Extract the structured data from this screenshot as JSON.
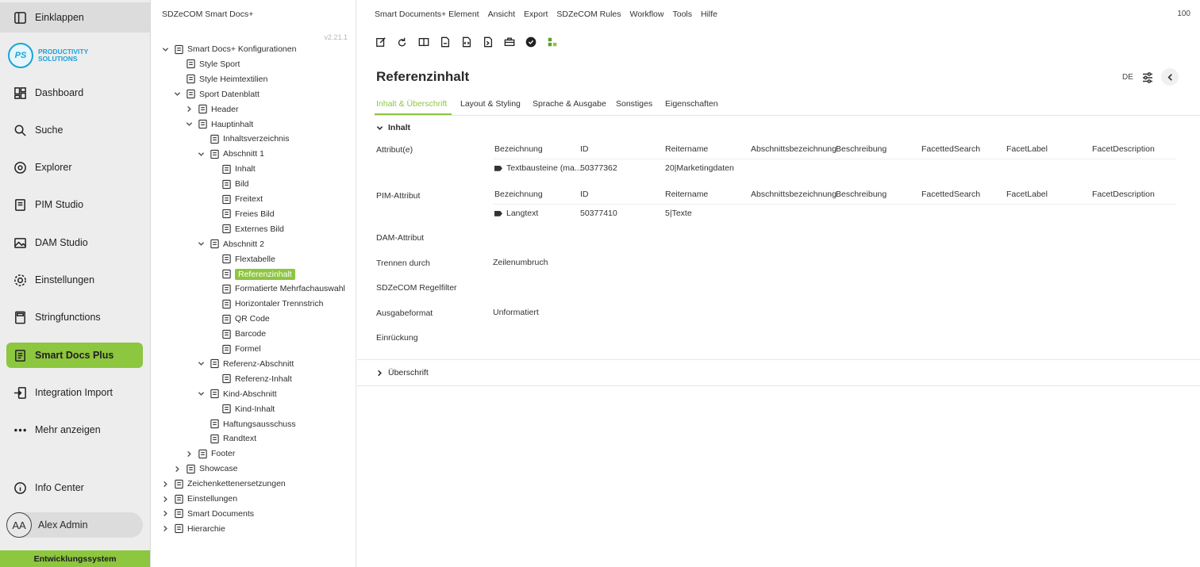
{
  "nav": {
    "collapse": "Einklappen",
    "logo_line1": "PRODUCTIVITY",
    "logo_line2": "SOLUTIONS",
    "logo_badge": "PS",
    "items": [
      {
        "label": "Dashboard",
        "icon": "dashboard-icon"
      },
      {
        "label": "Suche",
        "icon": "search-icon"
      },
      {
        "label": "Explorer",
        "icon": "explorer-icon"
      },
      {
        "label": "PIM Studio",
        "icon": "pim-icon"
      },
      {
        "label": "DAM Studio",
        "icon": "image-icon"
      },
      {
        "label": "Einstellungen",
        "icon": "gear-icon"
      },
      {
        "label": "Stringfunctions",
        "icon": "calculator-icon"
      },
      {
        "label": "Smart Docs Plus",
        "icon": "docs-icon",
        "active": true
      },
      {
        "label": "Integration Import",
        "icon": "import-icon"
      },
      {
        "label": "Mehr anzeigen",
        "icon": "more-icon"
      }
    ],
    "info": "Info Center",
    "user_initials": "AA",
    "user_name": "Alex Admin",
    "environment": "Entwicklungssystem",
    "accent": "#8dc63f"
  },
  "tree": {
    "header": "SDZeCOM Smart Docs+",
    "version": "v2.21.1",
    "nodes": [
      {
        "label": "Smart Docs+ Konfigurationen",
        "expanded": true
      },
      {
        "label": "Style Sport"
      },
      {
        "label": "Style Heimtextilien"
      },
      {
        "label": "Sport Datenblatt",
        "expanded": true
      },
      {
        "label": "Header",
        "expanded": false
      },
      {
        "label": "Hauptinhalt",
        "expanded": true
      },
      {
        "label": "Inhaltsverzeichnis"
      },
      {
        "label": "Abschnitt 1",
        "expanded": true
      },
      {
        "label": "Inhalt"
      },
      {
        "label": "Bild"
      },
      {
        "label": "Freitext"
      },
      {
        "label": "Freies Bild"
      },
      {
        "label": "Externes Bild"
      },
      {
        "label": "Abschnitt 2",
        "expanded": true
      },
      {
        "label": "Flextabelle"
      },
      {
        "label": "Referenzinhalt",
        "selected": true
      },
      {
        "label": "Formatierte Mehrfachauswahl"
      },
      {
        "label": "Horizontaler Trennstrich"
      },
      {
        "label": "QR Code"
      },
      {
        "label": "Barcode"
      },
      {
        "label": "Formel"
      },
      {
        "label": "Referenz-Abschnitt",
        "expanded": true
      },
      {
        "label": "Referenz-Inhalt"
      },
      {
        "label": "Kind-Abschnitt",
        "expanded": true
      },
      {
        "label": "Kind-Inhalt"
      },
      {
        "label": "Haftungsausschuss"
      },
      {
        "label": "Randtext"
      },
      {
        "label": "Footer",
        "expanded": false
      },
      {
        "label": "Showcase",
        "expanded": false
      },
      {
        "label": "Zeichenkettenersetzungen",
        "expanded": false
      },
      {
        "label": "Einstellungen",
        "expanded": false
      },
      {
        "label": "Smart Documents",
        "expanded": false
      },
      {
        "label": "Hierarchie",
        "expanded": false
      }
    ]
  },
  "menu": [
    "Smart Documents+ Element",
    "Ansicht",
    "Export",
    "SDZeCOM Rules",
    "Workflow",
    "Tools",
    "Hilfe"
  ],
  "zoom": "100",
  "page_title": "Referenzinhalt",
  "language": "DE",
  "tabs": [
    "Inhalt & Überschrift",
    "Layout & Styling",
    "Sprache & Ausgabe",
    "Sonstiges",
    "Eigenschaften"
  ],
  "section_inhalt": "Inhalt",
  "section_ueberschrift": "Überschrift",
  "columns": [
    "Bezeichnung",
    "ID",
    "Reitername",
    "Abschnittsbezeichnung",
    "Beschreibung",
    "FacettedSearch",
    "FacetLabel",
    "FacetDescription"
  ],
  "fields": {
    "attribut": {
      "label": "Attribut(e)",
      "rows": [
        {
          "bezeichnung": "Textbausteine (ma...",
          "id": "50377362",
          "reitername": "20|Marketingdaten"
        }
      ]
    },
    "pim_attribut": {
      "label": "PIM-Attribut",
      "rows": [
        {
          "bezeichnung": "Langtext",
          "id": "50377410",
          "reitername": "5|Texte"
        }
      ]
    },
    "dam_attribut": {
      "label": "DAM-Attribut"
    },
    "trennen": {
      "label": "Trennen durch",
      "value": "Zeilenumbruch"
    },
    "regelfilter": {
      "label": "SDZeCOM Regelfilter"
    },
    "ausgabeformat": {
      "label": "Ausgabeformat",
      "value": "Unformatiert"
    },
    "einrueckung": {
      "label": "Einrückung"
    }
  }
}
